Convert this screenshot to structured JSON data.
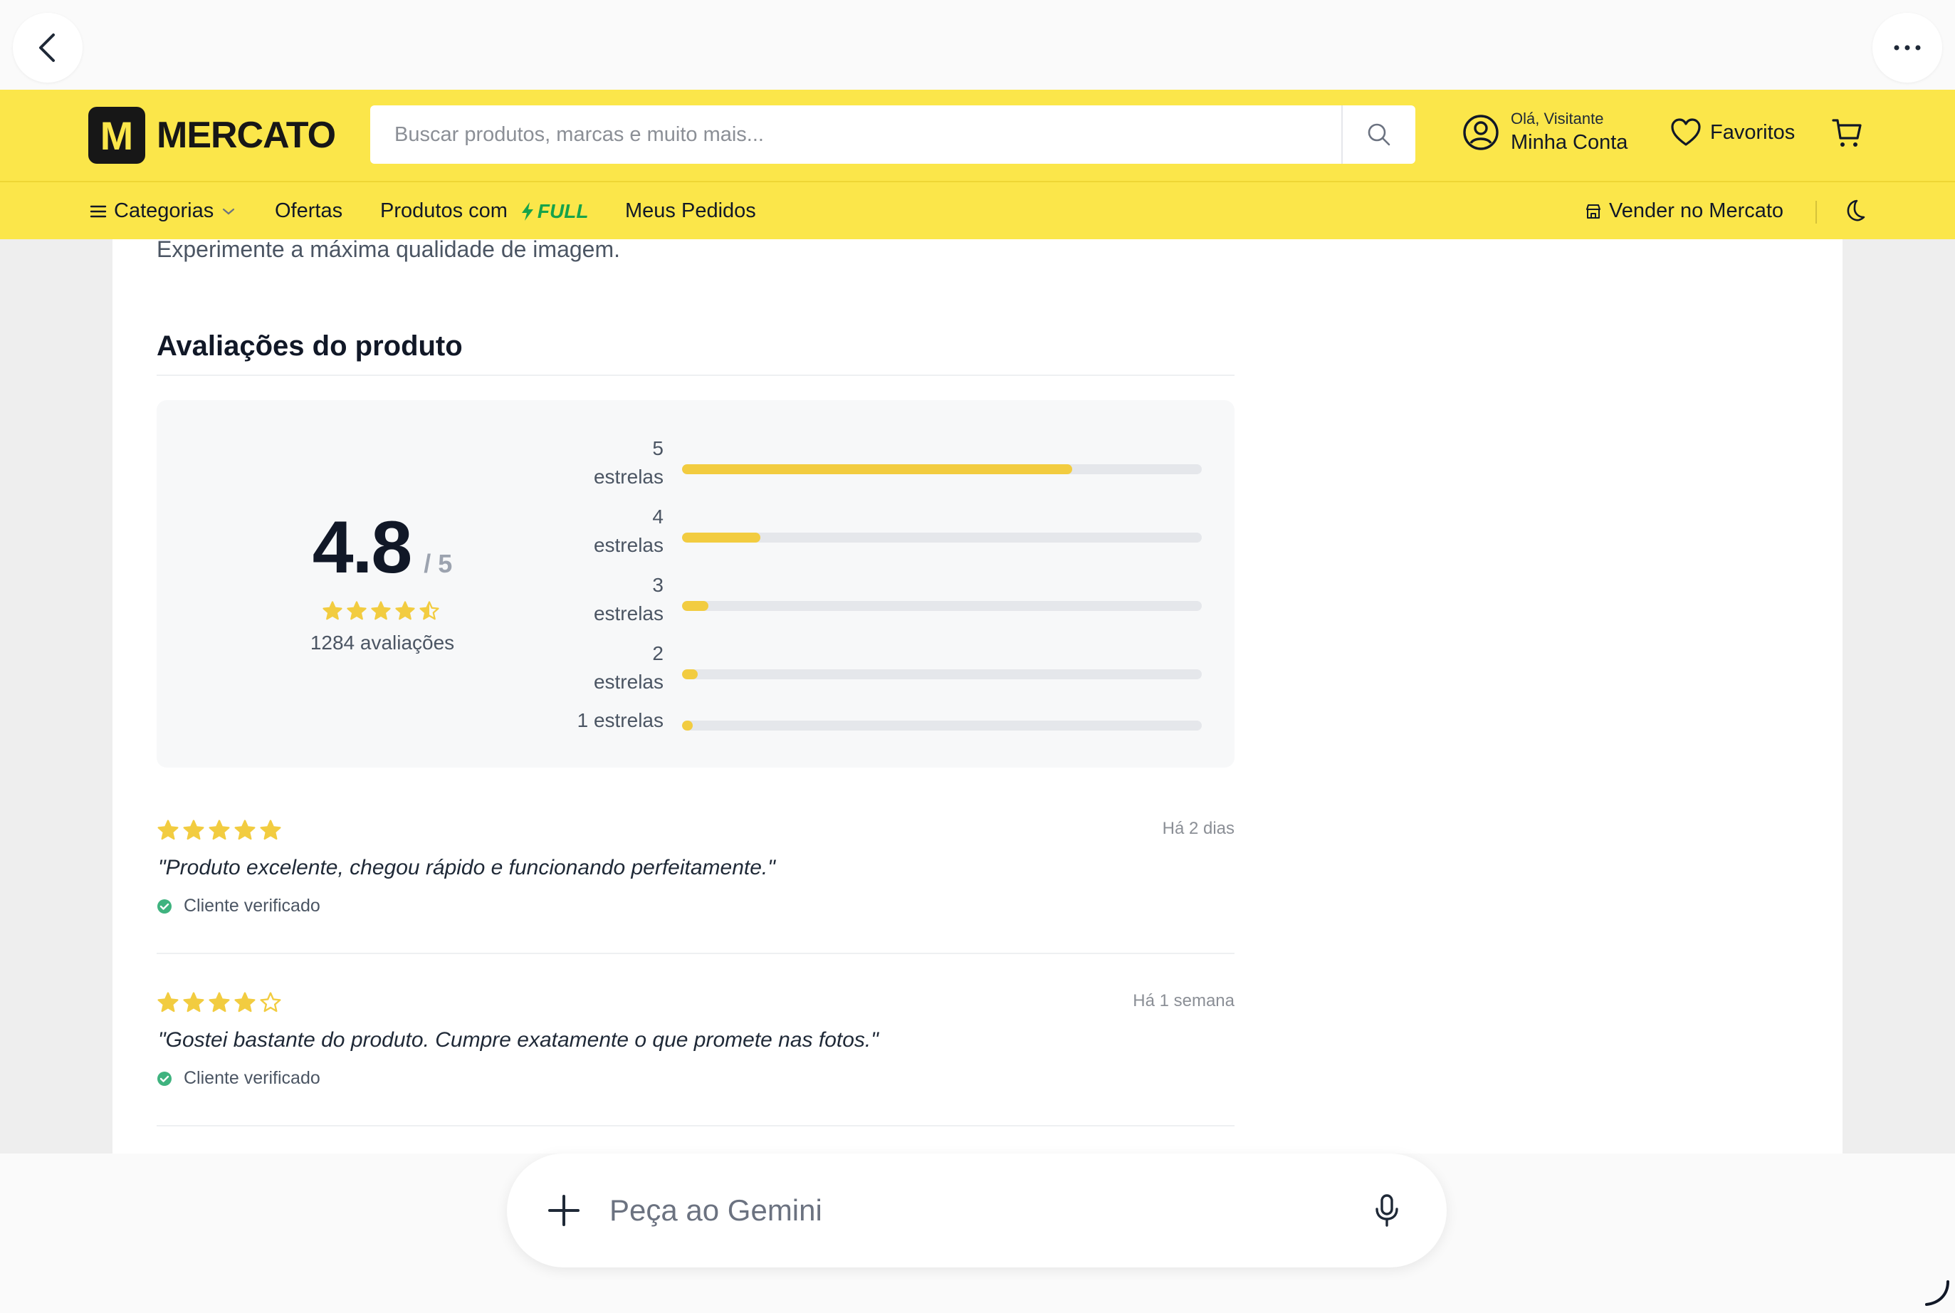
{
  "header": {
    "logo_letter": "M",
    "logo_text": "MERCATO",
    "search_placeholder": "Buscar produtos, marcas e muito mais...",
    "account_greeting": "Olá, Visitante",
    "account_label": "Minha Conta",
    "favorites_label": "Favoritos"
  },
  "nav": {
    "categories_label": "Categorias",
    "offers_label": "Ofertas",
    "products_full_label": "Produtos com",
    "full_badge": "FULL",
    "orders_label": "Meus Pedidos",
    "sell_label": "Vender no Mercato"
  },
  "product": {
    "description_tail": "Experimente a máxima qualidade de imagem."
  },
  "reviews": {
    "section_title": "Avaliações do produto",
    "average": "4.8",
    "scale": "/ 5",
    "average_stars": 4.5,
    "count_label": "1284 avaliações",
    "distribution": [
      {
        "label_num": "5",
        "label_word": "estrelas",
        "fraction": 0.75
      },
      {
        "label_num": "4",
        "label_word": "estrelas",
        "fraction": 0.15
      },
      {
        "label_num": "3",
        "label_word": "estrelas",
        "fraction": 0.05
      },
      {
        "label_num": "2",
        "label_word": "estrelas",
        "fraction": 0.03
      },
      {
        "label_num": "1 estrelas",
        "label_word": "",
        "fraction": 0.02
      }
    ],
    "items": [
      {
        "stars": 5,
        "date": "Há 2 dias",
        "text": "\"Produto excelente, chegou rápido e funcionando perfeitamente.\"",
        "verified": "Cliente verificado"
      },
      {
        "stars": 4,
        "date": "Há 1 semana",
        "text": "\"Gostei bastante do produto. Cumpre exatamente o que promete nas fotos.\"",
        "verified": "Cliente verificado"
      }
    ]
  },
  "assistant": {
    "placeholder": "Peça ao Gemini"
  },
  "colors": {
    "brand_yellow": "#fbe64a",
    "star_yellow": "#f2cc40",
    "verified_green": "#3fb37f",
    "full_green": "#16a34a"
  }
}
